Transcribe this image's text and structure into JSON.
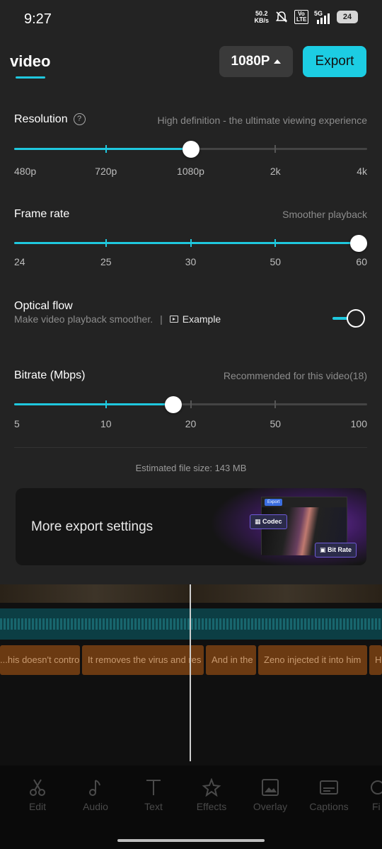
{
  "status_bar": {
    "time": "9:27",
    "net_speed_value": "50.2",
    "net_speed_unit": "KB/s",
    "volte": "Vo LTE",
    "network": "5G",
    "battery": "24"
  },
  "header": {
    "tab_label": "video",
    "resolution_select": "1080P",
    "export_label": "Export"
  },
  "resolution": {
    "title": "Resolution",
    "hint": "High definition - the ultimate viewing experience",
    "options": [
      "480p",
      "720p",
      "1080p",
      "2k",
      "4k"
    ],
    "selected_index": 2
  },
  "frame_rate": {
    "title": "Frame rate",
    "hint": "Smoother playback",
    "options": [
      "24",
      "25",
      "30",
      "50",
      "60"
    ],
    "selected_index": 4
  },
  "optical_flow": {
    "title": "Optical flow",
    "description": "Make video playback smoother.",
    "separator": "|",
    "example_label": "Example",
    "enabled": true
  },
  "bitrate": {
    "title": "Bitrate (Mbps)",
    "hint": "Recommended for this video(18)",
    "options": [
      "5",
      "10",
      "20",
      "50",
      "100"
    ],
    "value_fraction": 0.45
  },
  "estimated_size": "Estimated file size: 143 MB",
  "more_settings": {
    "label": "More export settings",
    "preview_tag": "Export",
    "codec_badge": "Codec",
    "bitrate_badge": "Bit Rate"
  },
  "timeline": {
    "captions": [
      "...his doesn't control",
      "It removes the virus and res",
      "And in the",
      "Zeno injected it into him",
      "H"
    ]
  },
  "toolbar": {
    "items": [
      {
        "label": "Edit",
        "icon": "scissors-icon"
      },
      {
        "label": "Audio",
        "icon": "music-note-icon"
      },
      {
        "label": "Text",
        "icon": "text-icon"
      },
      {
        "label": "Effects",
        "icon": "effects-star-icon"
      },
      {
        "label": "Overlay",
        "icon": "overlay-image-icon"
      },
      {
        "label": "Captions",
        "icon": "captions-icon"
      },
      {
        "label": "Fi",
        "icon": "filter-icon"
      }
    ]
  },
  "colors": {
    "accent": "#1fc8de",
    "export_button": "#1ccde3",
    "sheet_bg": "#232323"
  }
}
